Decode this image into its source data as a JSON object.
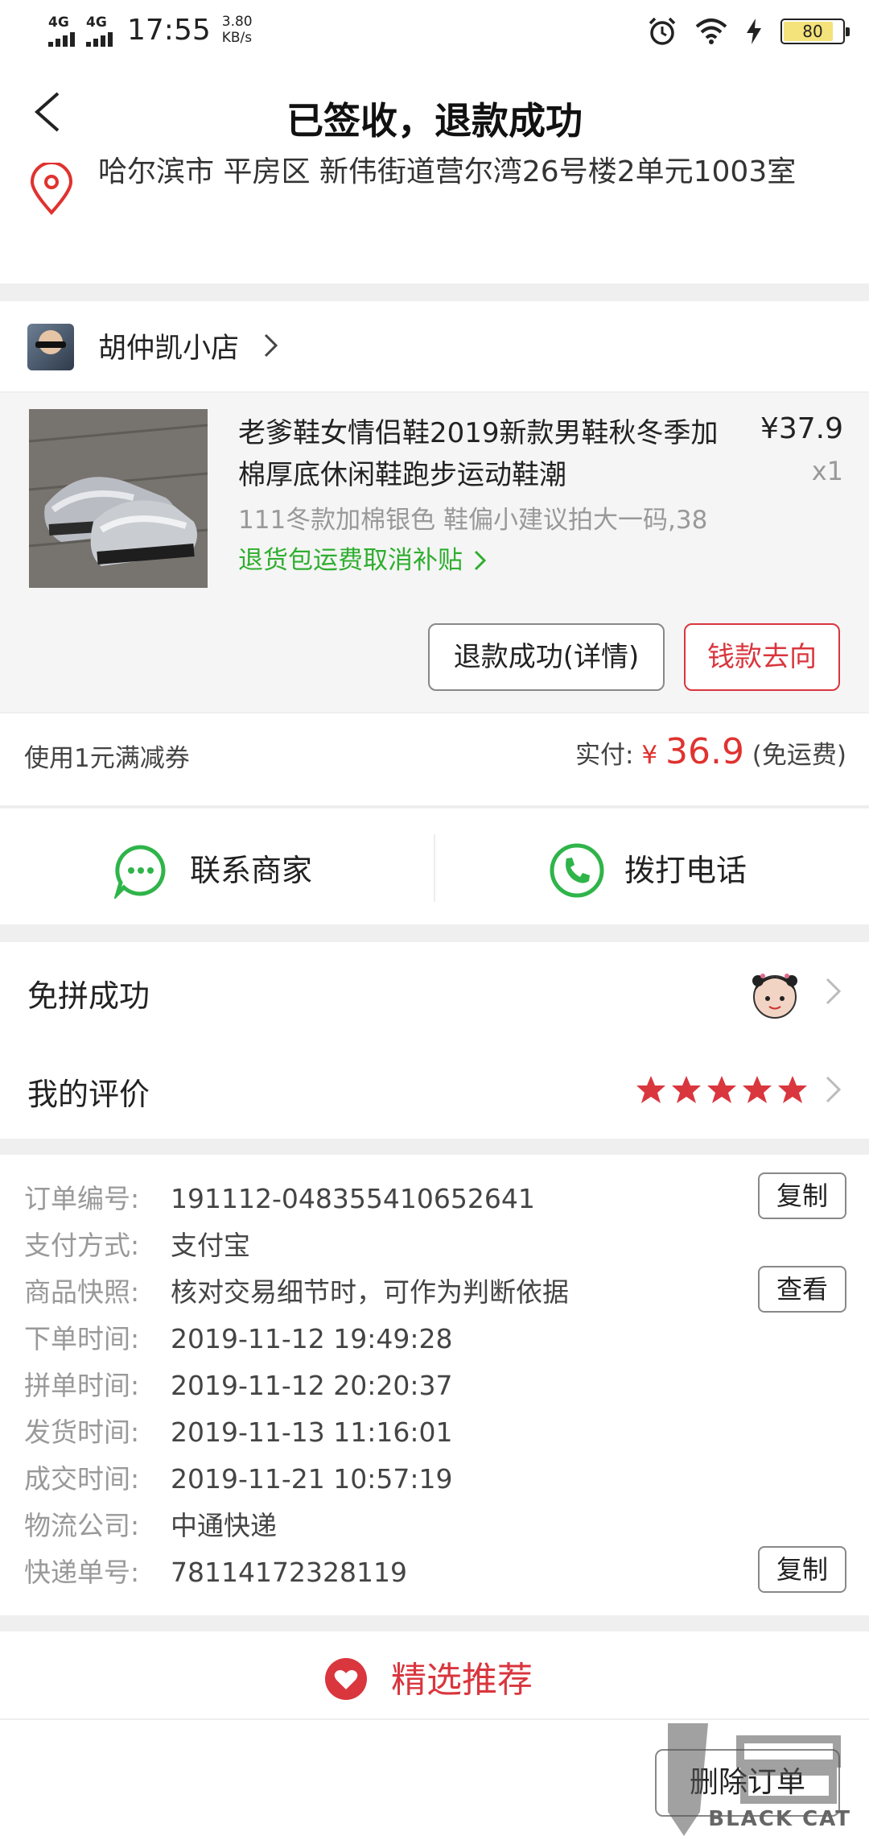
{
  "status_bar": {
    "network_1": "4G",
    "network_2": "4G",
    "time": "17:55",
    "speed_value": "3.80",
    "speed_unit": "KB/s",
    "battery": "80"
  },
  "header": {
    "title": "已签收，退款成功"
  },
  "address": {
    "text": "哈尔滨市 平房区 新伟街道营尔湾26号楼2单元1003室"
  },
  "shop": {
    "name": "胡仲凯小店"
  },
  "product": {
    "title": "老爹鞋女情侣鞋2019新款男鞋秋冬季加棉厚底休闲鞋跑步运动鞋潮",
    "price": "¥37.9",
    "quantity": "x1",
    "sku": "111冬款加棉银色 鞋偏小建议拍大一码,38",
    "promo": "退货包运费取消补贴"
  },
  "actions": {
    "refund_detail": "退款成功(详情)",
    "money_flow": "钱款去向"
  },
  "payment": {
    "coupon": "使用1元满减券",
    "paid_label": "实付:",
    "currency": "¥",
    "amount": "36.9",
    "shipping": "(免运费)"
  },
  "contact": {
    "merchant": "联系商家",
    "phone": "拨打电话"
  },
  "status_rows": {
    "group": "免拼成功",
    "review": "我的评价",
    "rating": 5
  },
  "order_info": {
    "rows": [
      {
        "key": "订单编号:",
        "value": "191112-048355410652641"
      },
      {
        "key": "支付方式:",
        "value": "支付宝"
      },
      {
        "key": "商品快照:",
        "value": "核对交易细节时，可作为判断依据"
      },
      {
        "key": "下单时间:",
        "value": "2019-11-12 19:49:28"
      },
      {
        "key": "拼单时间:",
        "value": "2019-11-12 20:20:37"
      },
      {
        "key": "发货时间:",
        "value": "2019-11-13 11:16:01"
      },
      {
        "key": "成交时间:",
        "value": "2019-11-21 10:57:19"
      },
      {
        "key": "物流公司:",
        "value": "中通快递"
      },
      {
        "key": "快递单号:",
        "value": "78114172328119"
      }
    ],
    "copy_label": "复制",
    "view_label": "查看"
  },
  "recommend": {
    "label": "精选推荐"
  },
  "bottom": {
    "delete_order": "删除订单",
    "watermark": "BLACK CAT"
  },
  "colors": {
    "accent_red": "#d9363e",
    "promo_green": "#2fae2f",
    "wechat_green": "#2fb44a"
  }
}
